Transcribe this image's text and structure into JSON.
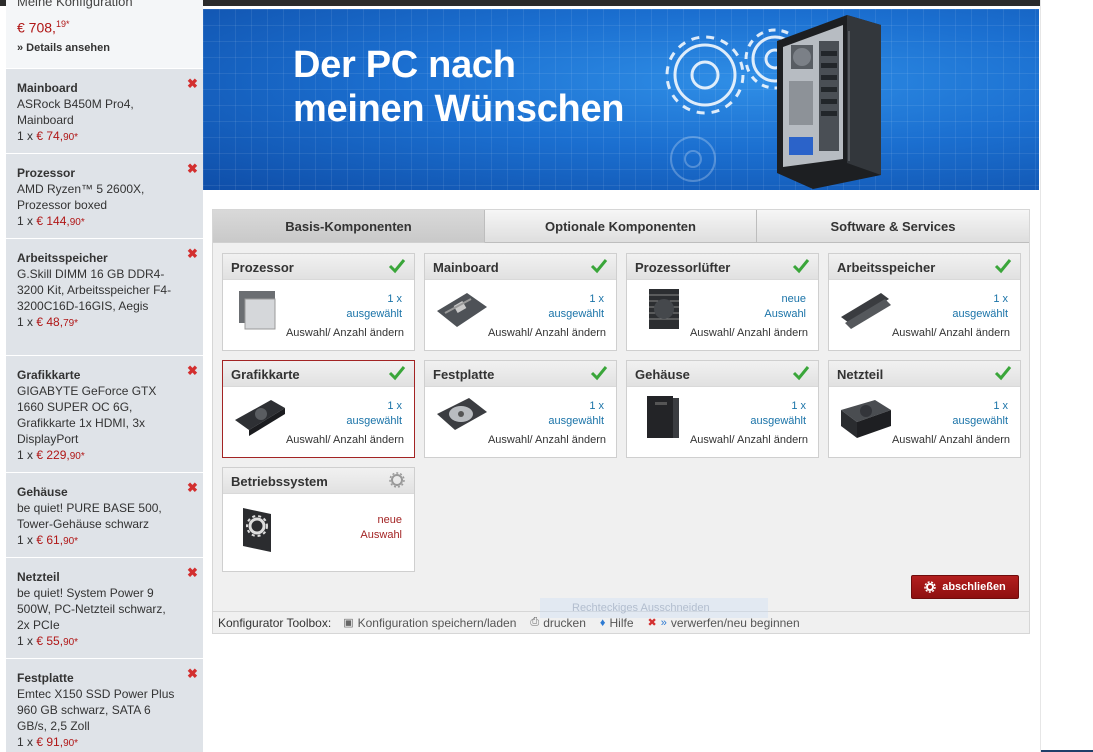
{
  "sidebar": {
    "header_title": "Meine Konfiguration",
    "total_main": "€ 708,",
    "total_cents": "19*",
    "details_link": "» Details ansehen",
    "items": [
      {
        "category": "Mainboard",
        "name": "ASRock B450M Pro4, Mainboard",
        "qty": "1 x",
        "price_main": "€ 74,",
        "price_cents": "90*"
      },
      {
        "category": "Prozessor",
        "name": "AMD Ryzen™ 5 2600X, Prozessor boxed",
        "qty": "1 x",
        "price_main": "€ 144,",
        "price_cents": "90*"
      },
      {
        "category": "Arbeitsspeicher",
        "name": "G.Skill DIMM 16 GB DDR4-3200 Kit, Arbeitsspeicher F4-3200C16D-16GIS, Aegis",
        "qty": "1 x",
        "price_main": "€ 48,",
        "price_cents": "79*"
      },
      {
        "category": "Grafikkarte",
        "name": "GIGABYTE GeForce GTX 1660 SUPER OC 6G, Grafikkarte 1x HDMI, 3x DisplayPort",
        "qty": "1 x",
        "price_main": "€ 229,",
        "price_cents": "90*"
      },
      {
        "category": "Gehäuse",
        "name": "be quiet! PURE BASE 500, Tower-Gehäuse schwarz",
        "qty": "1 x",
        "price_main": "€ 61,",
        "price_cents": "90*"
      },
      {
        "category": "Netzteil",
        "name": "be quiet! System Power 9 500W, PC-Netzteil schwarz, 2x PCIe",
        "qty": "1 x",
        "price_main": "€ 55,",
        "price_cents": "90*"
      },
      {
        "category": "Festplatte",
        "name": "Emtec X150 SSD Power Plus 960 GB schwarz, SATA 6 GB/s, 2,5 Zoll",
        "qty": "1 x",
        "price_main": "€ 91,",
        "price_cents": "90*"
      }
    ]
  },
  "banner": {
    "line1": "Der PC nach",
    "line2": "meinen Wünschen"
  },
  "tabs": [
    {
      "label": "Basis-Komponenten"
    },
    {
      "label": "Optionale Komponenten"
    },
    {
      "label": "Software & Services"
    }
  ],
  "cards": [
    {
      "title": "Prozessor",
      "status1": "1 x",
      "status2": "ausgewählt",
      "change": "Auswahl/ Anzahl ändern",
      "icon": "cpu-icon"
    },
    {
      "title": "Mainboard",
      "status1": "1 x",
      "status2": "ausgewählt",
      "change": "Auswahl/ Anzahl ändern",
      "icon": "mainboard-icon"
    },
    {
      "title": "Prozessorlüfter",
      "status1": "neue",
      "status2": "Auswahl",
      "change": "Auswahl/ Anzahl ändern",
      "icon": "cooler-icon"
    },
    {
      "title": "Arbeitsspeicher",
      "status1": "1 x",
      "status2": "ausgewählt",
      "change": "Auswahl/ Anzahl ändern",
      "icon": "ram-icon"
    },
    {
      "title": "Grafikkarte",
      "status1": "1 x",
      "status2": "ausgewählt",
      "change": "Auswahl/ Anzahl ändern",
      "icon": "gpu-icon"
    },
    {
      "title": "Festplatte",
      "status1": "1 x",
      "status2": "ausgewählt",
      "change": "Auswahl/ Anzahl ändern",
      "icon": "hdd-icon"
    },
    {
      "title": "Gehäuse",
      "status1": "1 x",
      "status2": "ausgewählt",
      "change": "Auswahl/ Anzahl ändern",
      "icon": "case-icon"
    },
    {
      "title": "Netzteil",
      "status1": "1 x",
      "status2": "ausgewählt",
      "change": "Auswahl/ Anzahl ändern",
      "icon": "psu-icon"
    },
    {
      "title": "Betriebssystem",
      "status1": "neue",
      "status2": "Auswahl",
      "icon": "os-icon"
    }
  ],
  "finish_button": "abschließen",
  "toolbox": {
    "label": "Konfigurator Toolbox:",
    "save": "Konfiguration speichern/laden",
    "print": "drucken",
    "help": "Hilfe",
    "reset": "verwerfen/neu beginnen"
  },
  "ghost_overlay": "Rechteckiges Ausschneiden",
  "colors": {
    "accent_red": "#b01616",
    "banner_blue": "#1b6fd0",
    "link_blue": "#1a73a8"
  }
}
